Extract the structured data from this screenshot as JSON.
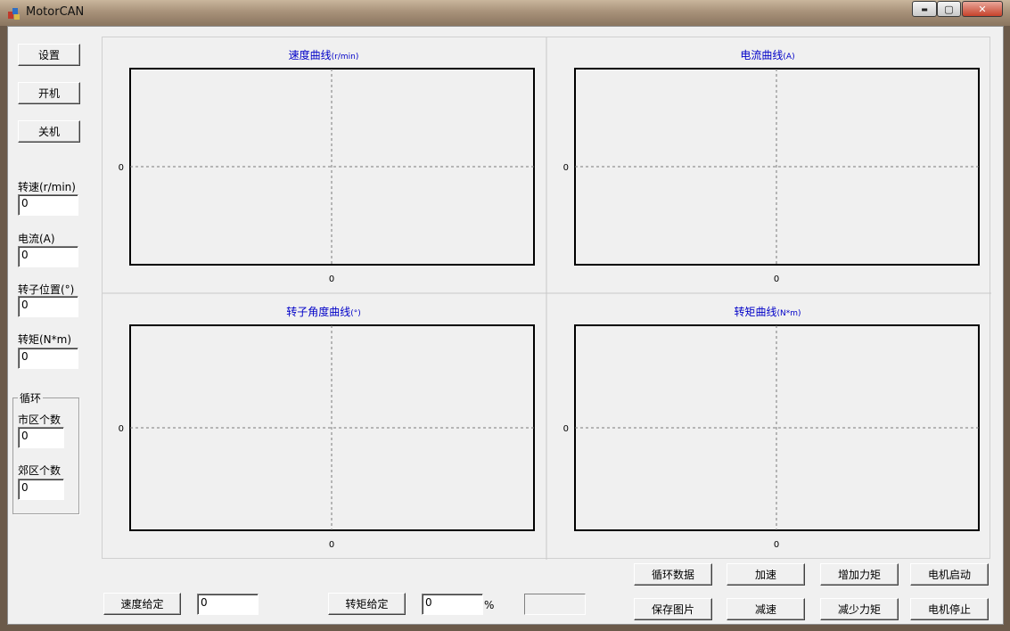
{
  "window": {
    "title": "MotorCAN",
    "min": "▬",
    "max": "▢",
    "close": "✕"
  },
  "left": {
    "buttons": {
      "settings": "设置",
      "power_on": "开机",
      "power_off": "关机"
    },
    "speed": {
      "label": "转速(r/min)",
      "value": "0"
    },
    "current": {
      "label": "电流(A)",
      "value": "0"
    },
    "rotor": {
      "label": "转子位置(°)",
      "value": "0"
    },
    "torque": {
      "label": "转矩(N*m)",
      "value": "0"
    },
    "cycle": {
      "title": "循环",
      "urban_label": "市区个数",
      "urban_value": "0",
      "suburban_label": "郊区个数",
      "suburban_value": "0"
    }
  },
  "charts": [
    {
      "title": "速度曲线",
      "unit": "(r/min)",
      "y_tick": "0",
      "x_tick": "0"
    },
    {
      "title": "电流曲线",
      "unit": "(A)",
      "y_tick": "0",
      "x_tick": "0"
    },
    {
      "title": "转子角度曲线",
      "unit": "(°)",
      "y_tick": "0",
      "x_tick": "0"
    },
    {
      "title": "转矩曲线",
      "unit": "(N*m)",
      "y_tick": "0",
      "x_tick": "0"
    }
  ],
  "bottom": {
    "speed_set_label": "速度给定",
    "speed_set_value": "0",
    "torque_set_label": "转矩给定",
    "torque_set_value": "0",
    "percent": "%",
    "cycle_data": "循环数据",
    "save_image": "保存图片",
    "accelerate": "加速",
    "decelerate": "减速",
    "torque_up": "增加力矩",
    "torque_down": "减少力矩",
    "motor_start": "电机启动",
    "motor_stop": "电机停止"
  },
  "colors": {
    "chart_title": "#0000c8",
    "grid": "#7a7a7a"
  }
}
